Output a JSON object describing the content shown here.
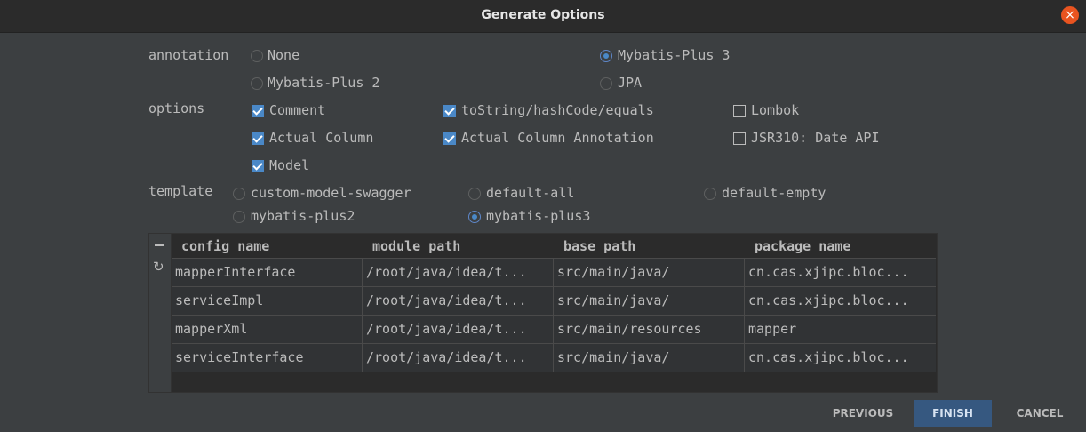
{
  "window": {
    "title": "Generate Options"
  },
  "annotation": {
    "label": "annotation",
    "options": [
      {
        "label": "None",
        "selected": false
      },
      {
        "label": "Mybatis-Plus 3",
        "selected": true
      },
      {
        "label": "Mybatis-Plus 2",
        "selected": false
      },
      {
        "label": "JPA",
        "selected": false
      }
    ]
  },
  "options": {
    "label": "options",
    "items": [
      {
        "label": "Comment",
        "checked": true
      },
      {
        "label": "toString/hashCode/equals",
        "checked": true
      },
      {
        "label": "Lombok",
        "checked": false
      },
      {
        "label": "Actual Column",
        "checked": true
      },
      {
        "label": "Actual Column Annotation",
        "checked": true
      },
      {
        "label": "JSR310: Date API",
        "checked": false
      },
      {
        "label": "Model",
        "checked": true
      }
    ]
  },
  "template": {
    "label": "template",
    "options": [
      {
        "label": "custom-model-swagger",
        "selected": false
      },
      {
        "label": "default-all",
        "selected": false
      },
      {
        "label": "default-empty",
        "selected": false
      },
      {
        "label": "mybatis-plus2",
        "selected": false
      },
      {
        "label": "mybatis-plus3",
        "selected": true
      }
    ]
  },
  "table": {
    "headers": [
      "config name",
      "module path",
      "base path",
      "package name"
    ],
    "rows": [
      [
        "mapperInterface",
        "/root/java/idea/t...",
        "src/main/java/",
        "cn.cas.xjipc.bloc..."
      ],
      [
        "serviceImpl",
        "/root/java/idea/t...",
        "src/main/java/",
        "cn.cas.xjipc.bloc..."
      ],
      [
        "mapperXml",
        "/root/java/idea/t...",
        "src/main/resources",
        "mapper"
      ],
      [
        "serviceInterface",
        "/root/java/idea/t...",
        "src/main/java/",
        "cn.cas.xjipc.bloc..."
      ]
    ]
  },
  "buttons": {
    "previous": "PREVIOUS",
    "finish": "FINISH",
    "cancel": "CANCEL"
  },
  "colors": {
    "accent": "#4a88c7",
    "close": "#e95420",
    "primary_button": "#365880"
  }
}
